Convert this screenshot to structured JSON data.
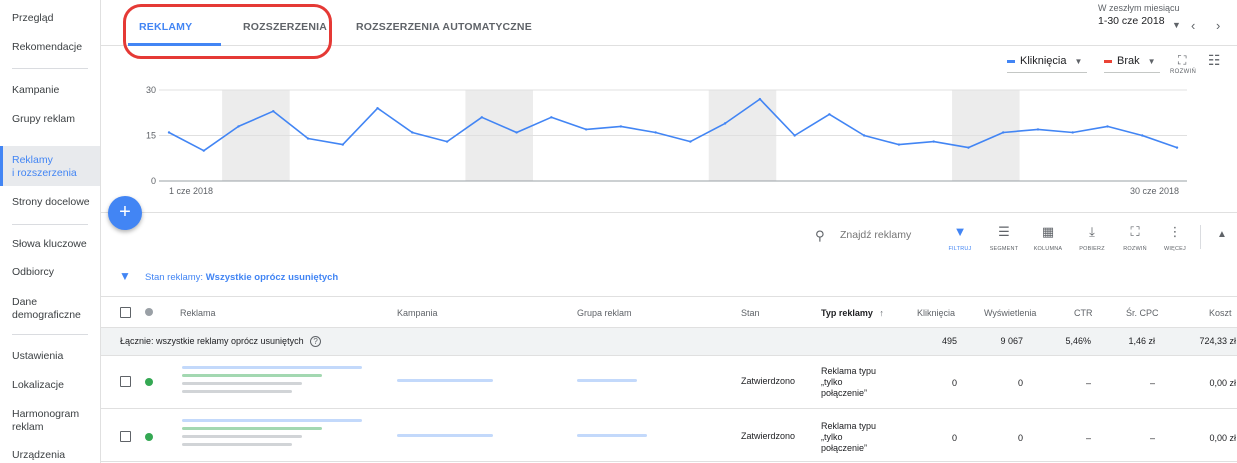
{
  "sidebar": {
    "items": [
      {
        "label": "Przegląd"
      },
      {
        "label": "Rekomendacje"
      },
      {
        "label": "Kampanie"
      },
      {
        "label": "Grupy reklam"
      },
      {
        "label": "Reklamy\ni rozszerzenia"
      },
      {
        "label": "Strony docelowe"
      },
      {
        "label": "Słowa kluczowe"
      },
      {
        "label": "Odbiorcy"
      },
      {
        "label": "Dane\ndemograficzne"
      },
      {
        "label": "Ustawienia"
      },
      {
        "label": "Lokalizacje"
      },
      {
        "label": "Harmonogram\nreklam"
      },
      {
        "label": "Urządzenia"
      }
    ],
    "active_index": 4
  },
  "tabs": [
    {
      "label": "REKLAMY"
    },
    {
      "label": "ROZSZERZENIA"
    },
    {
      "label": "ROZSZERZENIA AUTOMATYCZNE"
    }
  ],
  "date": {
    "caption": "W zeszłym miesiącu",
    "range": "1-30 cze 2018"
  },
  "chart_controls": {
    "metric1": "Kliknięcia",
    "metric2": "Brak",
    "expand_label": "ROZWIŃ",
    "metric1_color": "#4285f4",
    "metric2_color": "#ea4335"
  },
  "chart_data": {
    "type": "line",
    "x": [
      "1 cze 2018",
      "2",
      "3",
      "4",
      "5",
      "6",
      "7",
      "8",
      "9",
      "10",
      "11",
      "12",
      "13",
      "14",
      "15",
      "16",
      "17",
      "18",
      "19",
      "20",
      "21",
      "22",
      "23",
      "24",
      "25",
      "26",
      "27",
      "28",
      "29",
      "30 cze 2018"
    ],
    "series": [
      {
        "values": [
          16,
          10,
          18,
          23,
          14,
          12,
          24,
          16,
          13,
          21,
          16,
          21,
          17,
          18,
          16,
          13,
          19,
          27,
          15,
          22,
          15,
          12,
          13,
          11,
          16,
          17,
          16,
          18,
          15,
          11
        ]
      }
    ],
    "x_tick_labels": [
      "1 cze 2018",
      "30 cze 2018"
    ],
    "y_ticks": [
      0,
      15,
      30
    ],
    "ylim": [
      0,
      30
    ],
    "weekend_bands": [
      [
        2,
        3
      ],
      [
        9,
        10
      ],
      [
        16,
        17
      ],
      [
        23,
        24
      ]
    ],
    "color": "#4285f4",
    "grid": true
  },
  "toolbar": {
    "search_placeholder": "Znajdź reklamy",
    "tools": [
      {
        "label": "FILTRUJ",
        "icon": "filter-icon"
      },
      {
        "label": "SEGMENT",
        "icon": "segment-icon"
      },
      {
        "label": "KOLUMNA",
        "icon": "columns-icon"
      },
      {
        "label": "POBIERZ",
        "icon": "download-icon"
      },
      {
        "label": "ROZWIŃ",
        "icon": "expand-icon"
      },
      {
        "label": "WIĘCEJ",
        "icon": "more-icon"
      }
    ]
  },
  "filter": {
    "prefix": "Stan reklamy: ",
    "value": "Wszystkie oprócz usuniętych"
  },
  "table": {
    "columns": [
      "Reklama",
      "Kampania",
      "Grupa reklam",
      "Stan",
      "Typ reklamy",
      "Kliknięcia",
      "Wyświetlenia",
      "CTR",
      "Śr. CPC",
      "Koszt"
    ],
    "total": {
      "label": "Łącznie: wszystkie reklamy oprócz usuniętych",
      "clicks": "495",
      "impressions": "9 067",
      "ctr": "5,46%",
      "cpc": "1,46 zł",
      "cost": "724,33 zł"
    },
    "rows": [
      {
        "status": "Zatwierdzono",
        "type": "Reklama typu\n„tylko\npołączenie”",
        "clicks": "0",
        "impressions": "0",
        "ctr": "–",
        "cpc": "–",
        "cost": "0,00 zł"
      },
      {
        "status": "Zatwierdzono",
        "type": "Reklama typu\n„tylko\npołączenie”",
        "clicks": "0",
        "impressions": "0",
        "ctr": "–",
        "cpc": "–",
        "cost": "0,00 zł"
      }
    ]
  }
}
